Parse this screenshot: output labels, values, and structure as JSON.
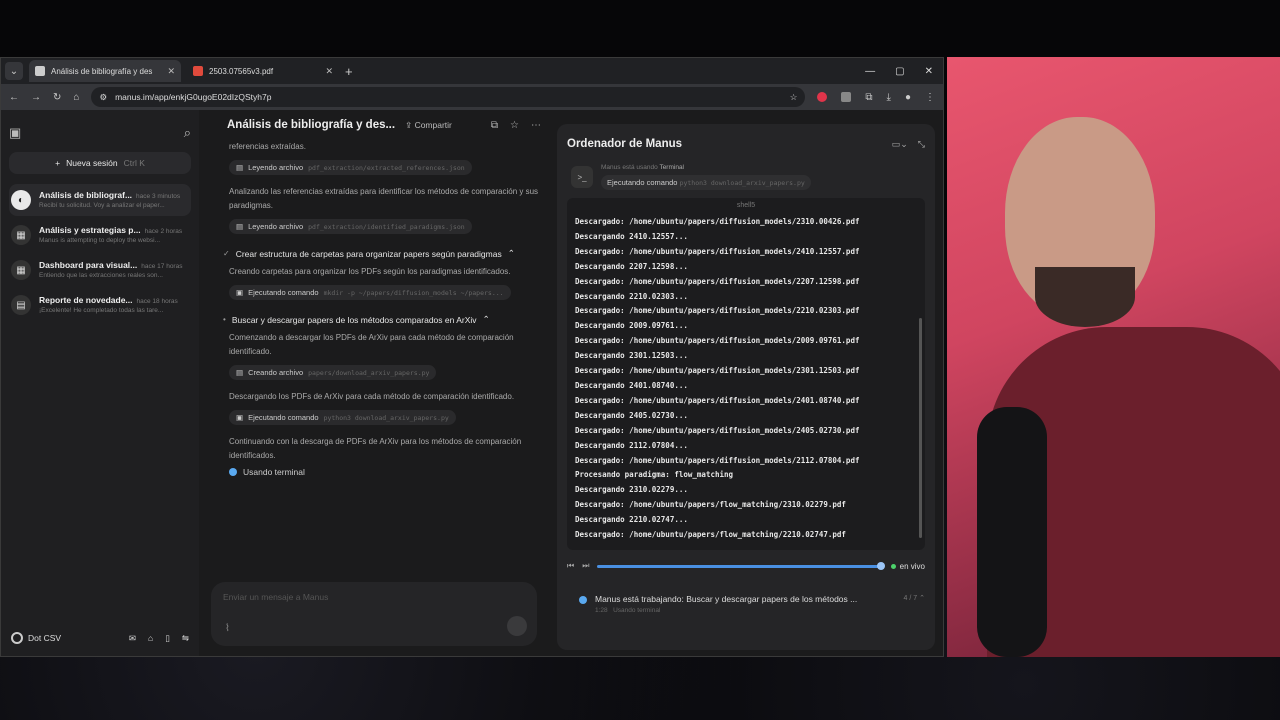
{
  "browser": {
    "tabs": [
      {
        "title": "Análisis de bibliografía y des",
        "active": true
      },
      {
        "title": "2503.07565v3.pdf",
        "active": false
      }
    ],
    "url": "manus.im/app/enkjG0ugoE02dIzQStyh7p"
  },
  "sidebar": {
    "new_session": "Nueva sesión",
    "new_session_shortcut": "Ctrl K",
    "sessions": [
      {
        "title": "Análisis de bibliograf...",
        "time": "hace 3 minutos",
        "sub": "Recibí tu solicitud. Voy a analizar el paper..."
      },
      {
        "title": "Análisis y estrategias p...",
        "time": "hace 2 horas",
        "sub": "Manus is attempting to deploy the websi..."
      },
      {
        "title": "Dashboard para visual...",
        "time": "hace 17 horas",
        "sub": "Entiendo que las extracciones reales son..."
      },
      {
        "title": "Reporte de novedade...",
        "time": "hace 18 horas",
        "sub": "¡Excelente! He completado todas las tare..."
      }
    ],
    "org": "Dot CSV"
  },
  "chat": {
    "title": "Análisis de bibliografía y des...",
    "share": "Compartir",
    "items": [
      {
        "kind": "msg",
        "text": "referencias extraídas."
      },
      {
        "kind": "action",
        "label": "Leyendo archivo",
        "detail": "pdf_extraction/extracted_references.json"
      },
      {
        "kind": "msg",
        "text": "Analizando las referencias extraídas para identificar los métodos de comparación y sus paradigmas."
      },
      {
        "kind": "action",
        "label": "Leyendo archivo",
        "detail": "pdf_extraction/identified_paradigms.json"
      },
      {
        "kind": "step",
        "text": "Crear estructura de carpetas para organizar papers según paradigmas"
      },
      {
        "kind": "msg",
        "text": "Creando carpetas para organizar los PDFs según los paradigmas identificados."
      },
      {
        "kind": "action",
        "label": "Ejecutando comando",
        "detail": "mkdir -p ~/papers/diffusion_models ~/papers..."
      },
      {
        "kind": "step",
        "text": "Buscar y descargar papers de los métodos comparados en ArXiv"
      },
      {
        "kind": "msg",
        "text": "Comenzando a descargar los PDFs de ArXiv para cada método de comparación identificado."
      },
      {
        "kind": "action",
        "label": "Creando archivo",
        "detail": "papers/download_arxiv_papers.py"
      },
      {
        "kind": "msg",
        "text": "Descargando los PDFs de ArXiv para cada método de comparación identificado."
      },
      {
        "kind": "action",
        "label": "Ejecutando comando",
        "detail": "python3 download_arxiv_papers.py"
      },
      {
        "kind": "msg",
        "text": "Continuando con la descarga de PDFs de ArXiv para los métodos de comparación identificados."
      }
    ],
    "status": "Usando terminal",
    "placeholder": "Enviar un mensaje a Manus"
  },
  "computer": {
    "title": "Ordenador de Manus",
    "using_label": "Manus está usando",
    "using_tool": "Terminal",
    "using_action": "Ejecutando comando",
    "using_cmd": "python3 download_arxiv_papers.py",
    "terminal_title": "shell5",
    "lines": [
      "Descargado: /home/ubuntu/papers/diffusion_models/2310.00426.pdf",
      "Descargando 2410.12557...",
      "Descargado: /home/ubuntu/papers/diffusion_models/2410.12557.pdf",
      "Descargando 2207.12598...",
      "Descargado: /home/ubuntu/papers/diffusion_models/2207.12598.pdf",
      "Descargando 2210.02303...",
      "Descargado: /home/ubuntu/papers/diffusion_models/2210.02303.pdf",
      "Descargando 2009.09761...",
      "Descargado: /home/ubuntu/papers/diffusion_models/2009.09761.pdf",
      "Descargando 2301.12503...",
      "Descargado: /home/ubuntu/papers/diffusion_models/2301.12503.pdf",
      "Descargando 2401.08740...",
      "Descargado: /home/ubuntu/papers/diffusion_models/2401.08740.pdf",
      "Descargando 2405.02730...",
      "Descargado: /home/ubuntu/papers/diffusion_models/2405.02730.pdf",
      "Descargando 2112.07804...",
      "Descargado: /home/ubuntu/papers/diffusion_models/2112.07804.pdf",
      "Procesando paradigma: flow_matching",
      "Descargando 2310.02279...",
      "Descargado: /home/ubuntu/papers/flow_matching/2310.02279.pdf",
      "Descargando 2210.02747...",
      "Descargado: /home/ubuntu/papers/flow_matching/2210.02747.pdf"
    ],
    "live": "en vivo",
    "progress_text": "Manus está trabajando: Buscar y descargar papers de los métodos ...",
    "progress_time": "1:28",
    "progress_sub": "Usando terminal",
    "progress_count": "4 / 7"
  }
}
